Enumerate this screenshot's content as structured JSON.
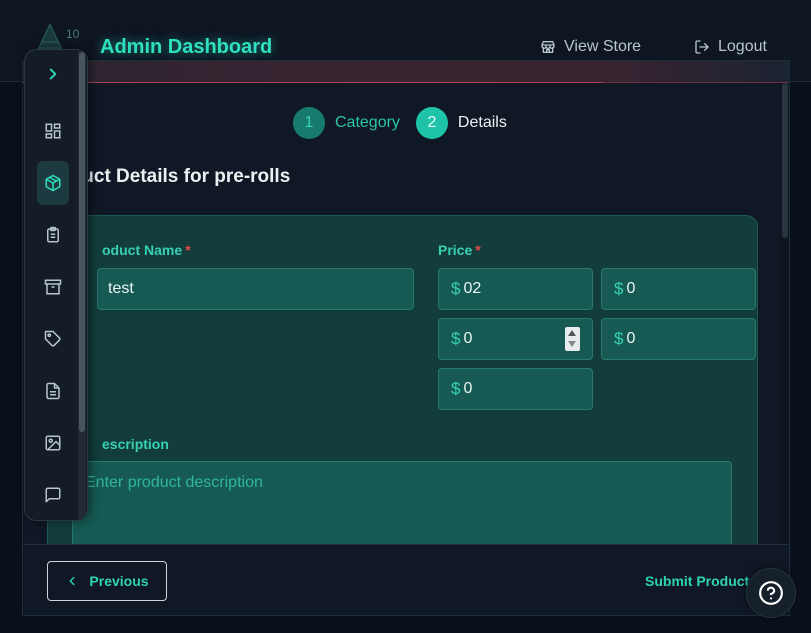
{
  "header": {
    "title": "Admin Dashboard",
    "view_store": "View Store",
    "logout": "Logout"
  },
  "stepper": {
    "steps": [
      {
        "number": "1",
        "label": "Category"
      },
      {
        "number": "2",
        "label": "Details"
      }
    ]
  },
  "form": {
    "section_title": "luct Details for pre-rolls",
    "product_name_label": "oduct Name",
    "required_mark": "*",
    "product_name_value": "test",
    "price_label": "Price",
    "currency_symbol": "$",
    "prices": [
      "02",
      "0",
      "0",
      "0",
      "0"
    ],
    "description_label": "escription",
    "description_placeholder": "Enter product description"
  },
  "footer": {
    "previous_label": "Previous",
    "submit_label": "Submit Product"
  },
  "sidebar": {
    "items": [
      "chevron-right-icon",
      "dashboard-grid-icon",
      "package-icon",
      "clipboard-icon",
      "archive-icon",
      "tag-icon",
      "document-icon",
      "image-icon",
      "message-icon"
    ],
    "active_item": "package-icon"
  },
  "colors": {
    "accent": "#2ee0bf",
    "panel": "#123d3b",
    "input": "#165a53",
    "required": "#e44b4b",
    "background": "#0b111c"
  }
}
